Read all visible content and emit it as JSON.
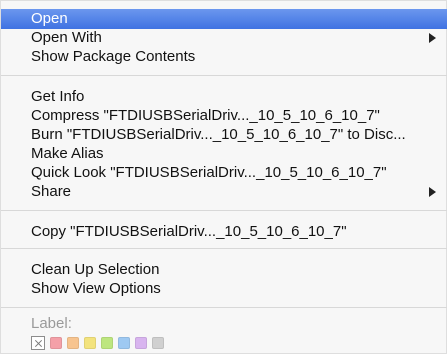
{
  "menu": {
    "selected_item": "open",
    "items": {
      "open": "Open",
      "open_with": "Open With",
      "show_package_contents": "Show Package Contents",
      "get_info": "Get Info",
      "compress": "Compress \"FTDIUSBSerialDriv..._10_5_10_6_10_7\"",
      "burn": "Burn \"FTDIUSBSerialDriv..._10_5_10_6_10_7\" to Disc...",
      "make_alias": "Make Alias",
      "quick_look": "Quick Look \"FTDIUSBSerialDriv..._10_5_10_6_10_7\"",
      "share": "Share",
      "copy": "Copy \"FTDIUSBSerialDriv..._10_5_10_6_10_7\"",
      "clean_up_selection": "Clean Up Selection",
      "show_view_options": "Show View Options"
    }
  },
  "labels": {
    "title": "Label:",
    "colors": [
      "#f4a0a8",
      "#f7c48f",
      "#f3e37d",
      "#bde67f",
      "#9ec9f2",
      "#d8b4ef",
      "#d0d0d0"
    ]
  }
}
